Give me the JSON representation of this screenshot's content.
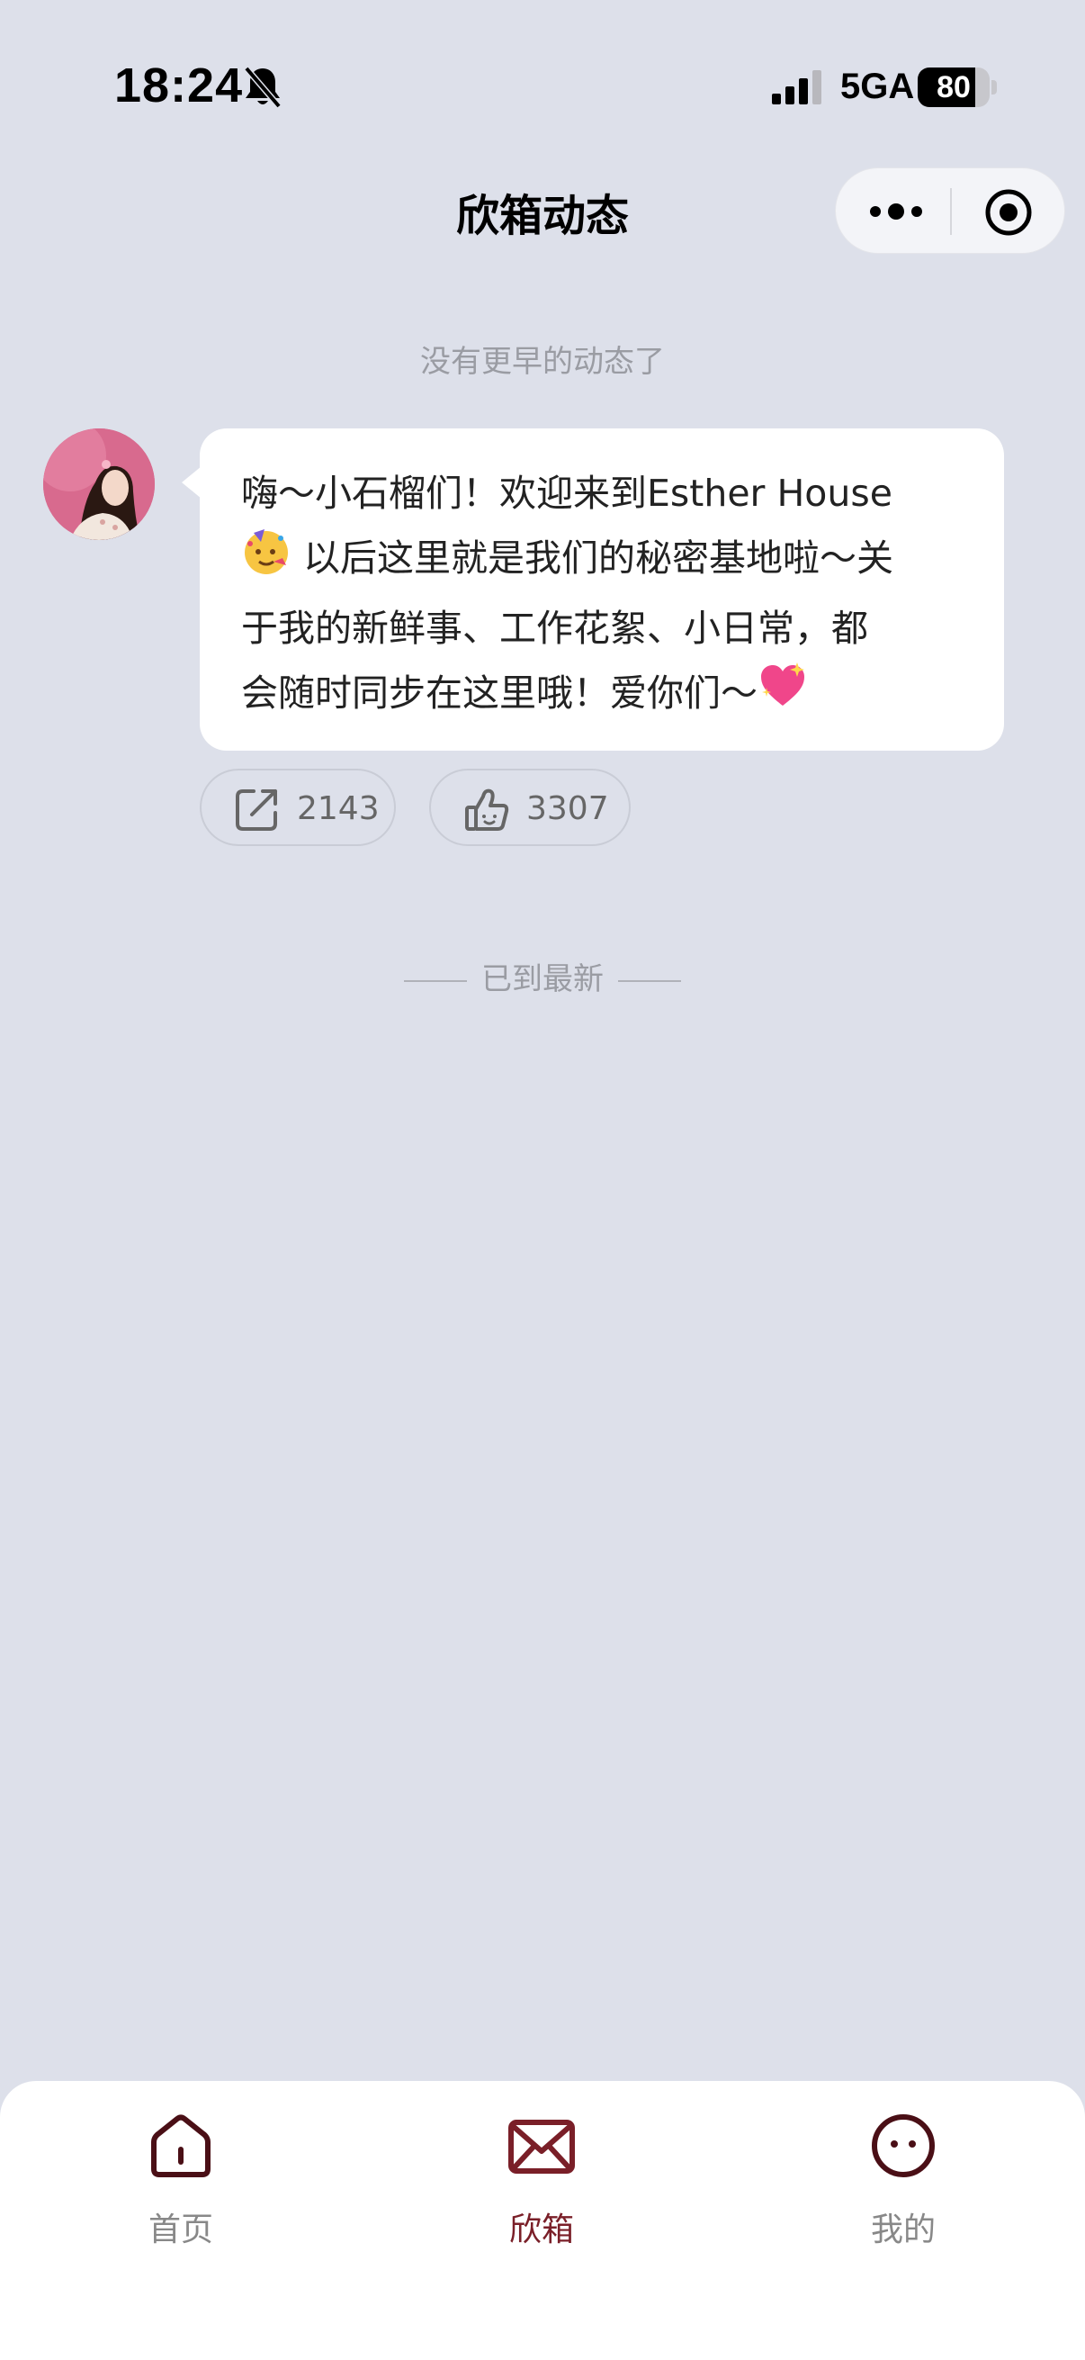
{
  "status_bar": {
    "time": "18:24",
    "network": "5GA",
    "battery_percent": "80",
    "battery_level": 0.8,
    "icons": [
      "bell-slash-icon",
      "signal-icon",
      "battery-icon"
    ]
  },
  "nav": {
    "title": "欣箱动态",
    "icons": [
      "more-icon",
      "target-icon"
    ]
  },
  "feed": {
    "top_hint": "没有更早的动态了",
    "message": {
      "line1": "嗨～小石榴们！欢迎来到Esther House",
      "line2": " 以后这里就是我们的秘密基地啦～关",
      "line3": "于我的新鲜事、工作花絮、小日常，都",
      "line4": "会随时同步在这里哦！爱你们～",
      "emoji_party": "🥳",
      "emoji_heart": "💖"
    },
    "share_count": "2143",
    "like_count": "3307",
    "bottom_hint": "已到最新"
  },
  "tabbar": {
    "tabs": [
      {
        "label": "首页",
        "icon": "home-icon",
        "active": false
      },
      {
        "label": "欣箱",
        "icon": "mail-icon",
        "active": true
      },
      {
        "label": "我的",
        "icon": "face-icon",
        "active": false
      }
    ]
  },
  "colors": {
    "background": "#dde0ea",
    "accent": "#7a1f28",
    "inactive": "#888888"
  }
}
